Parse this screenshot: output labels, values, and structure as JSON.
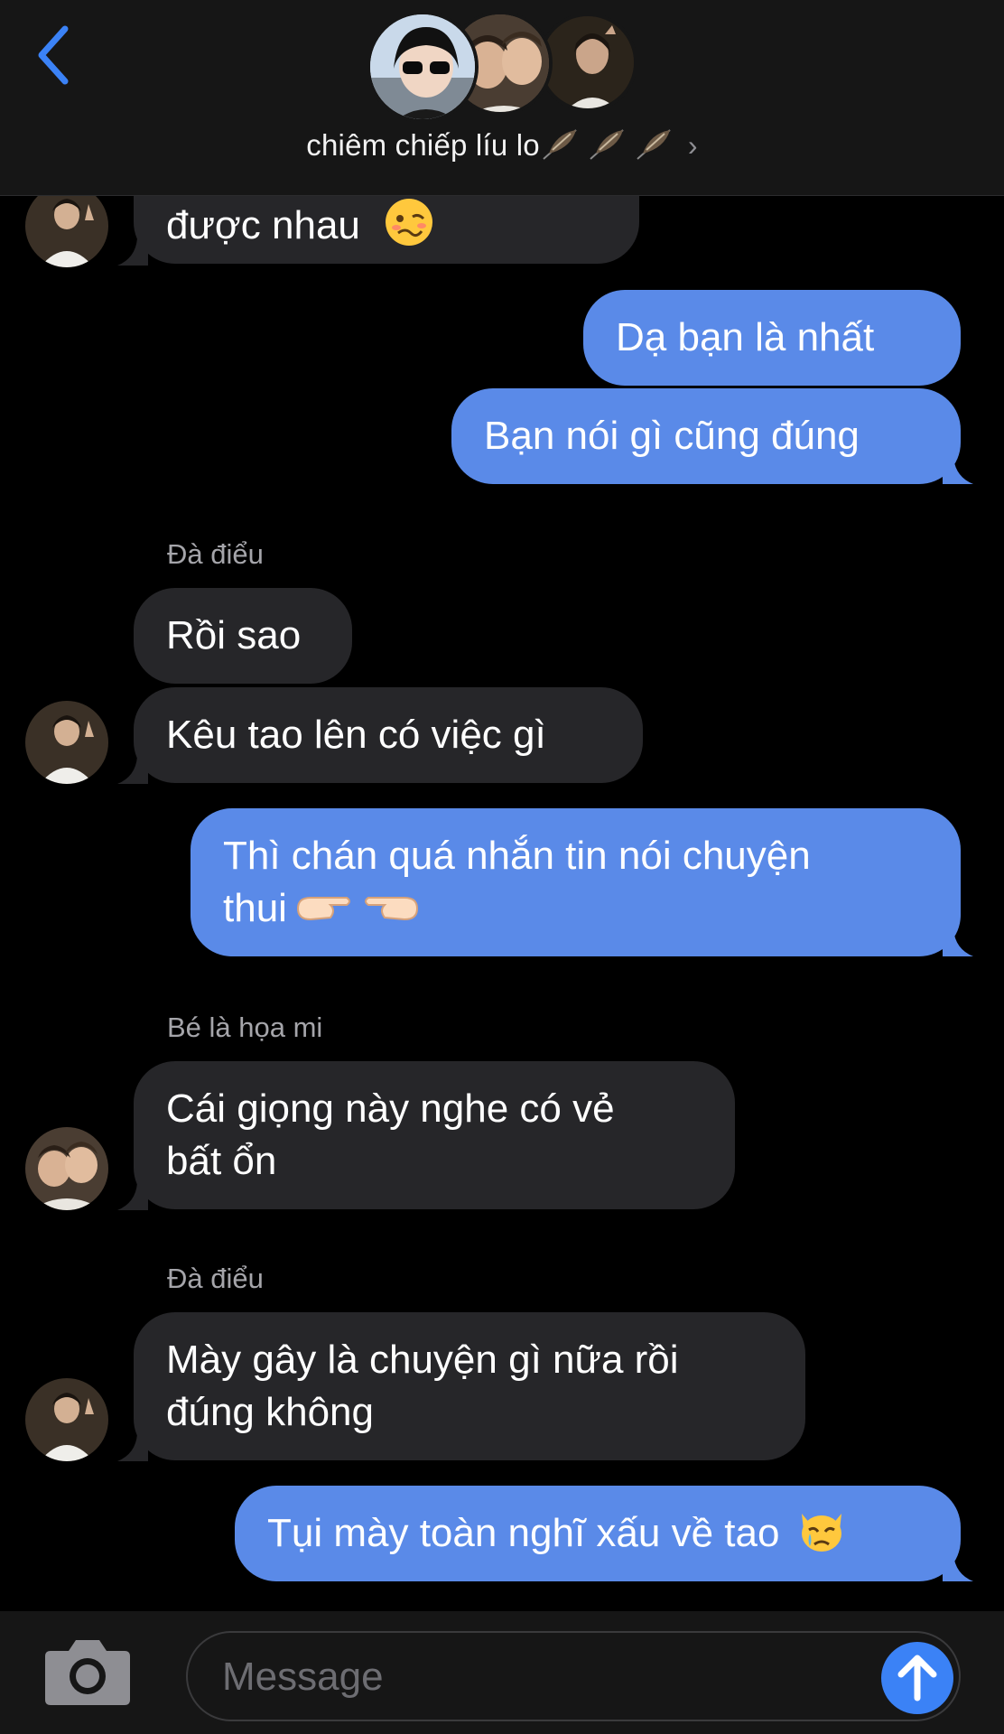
{
  "header": {
    "title": "chiêm chiếp líu lo",
    "title_suffix_icons": [
      "feather-icon",
      "feather-icon",
      "feather-icon"
    ],
    "chevron": "›",
    "participants": [
      "avatar-1",
      "avatar-2",
      "avatar-3"
    ]
  },
  "messages": [
    {
      "dir": "in",
      "text": "được nhau",
      "emoji": "woozy-face"
    },
    {
      "dir": "out",
      "text": "Dạ bạn là nhất"
    },
    {
      "dir": "out",
      "text": "Bạn nói gì cũng đúng"
    },
    {
      "sender": "Đà điểu"
    },
    {
      "dir": "in",
      "text": "Rồi sao"
    },
    {
      "dir": "in",
      "text": "Kêu tao lên có việc gì"
    },
    {
      "dir": "out",
      "lines": [
        "Thì chán quá nhắn tin nói chuyện",
        "thui"
      ],
      "emoji": "pointing-hands"
    },
    {
      "sender": "Bé là họa mi"
    },
    {
      "dir": "in",
      "lines": [
        "Cái giọng này nghe có vẻ",
        "bất ổn"
      ]
    },
    {
      "sender": "Đà điểu"
    },
    {
      "dir": "in",
      "lines": [
        "Mày gây là chuyện gì nữa rồi",
        "đúng không"
      ]
    },
    {
      "dir": "out",
      "text": "Tụi mày toàn nghĩ xấu về tao",
      "emoji": "crying-cat-face"
    }
  ],
  "composer": {
    "placeholder": "Message"
  },
  "colors": {
    "incoming_bubble": "#262629",
    "outgoing_bubble": "#5a8ae8",
    "accent": "#3b82f6"
  }
}
